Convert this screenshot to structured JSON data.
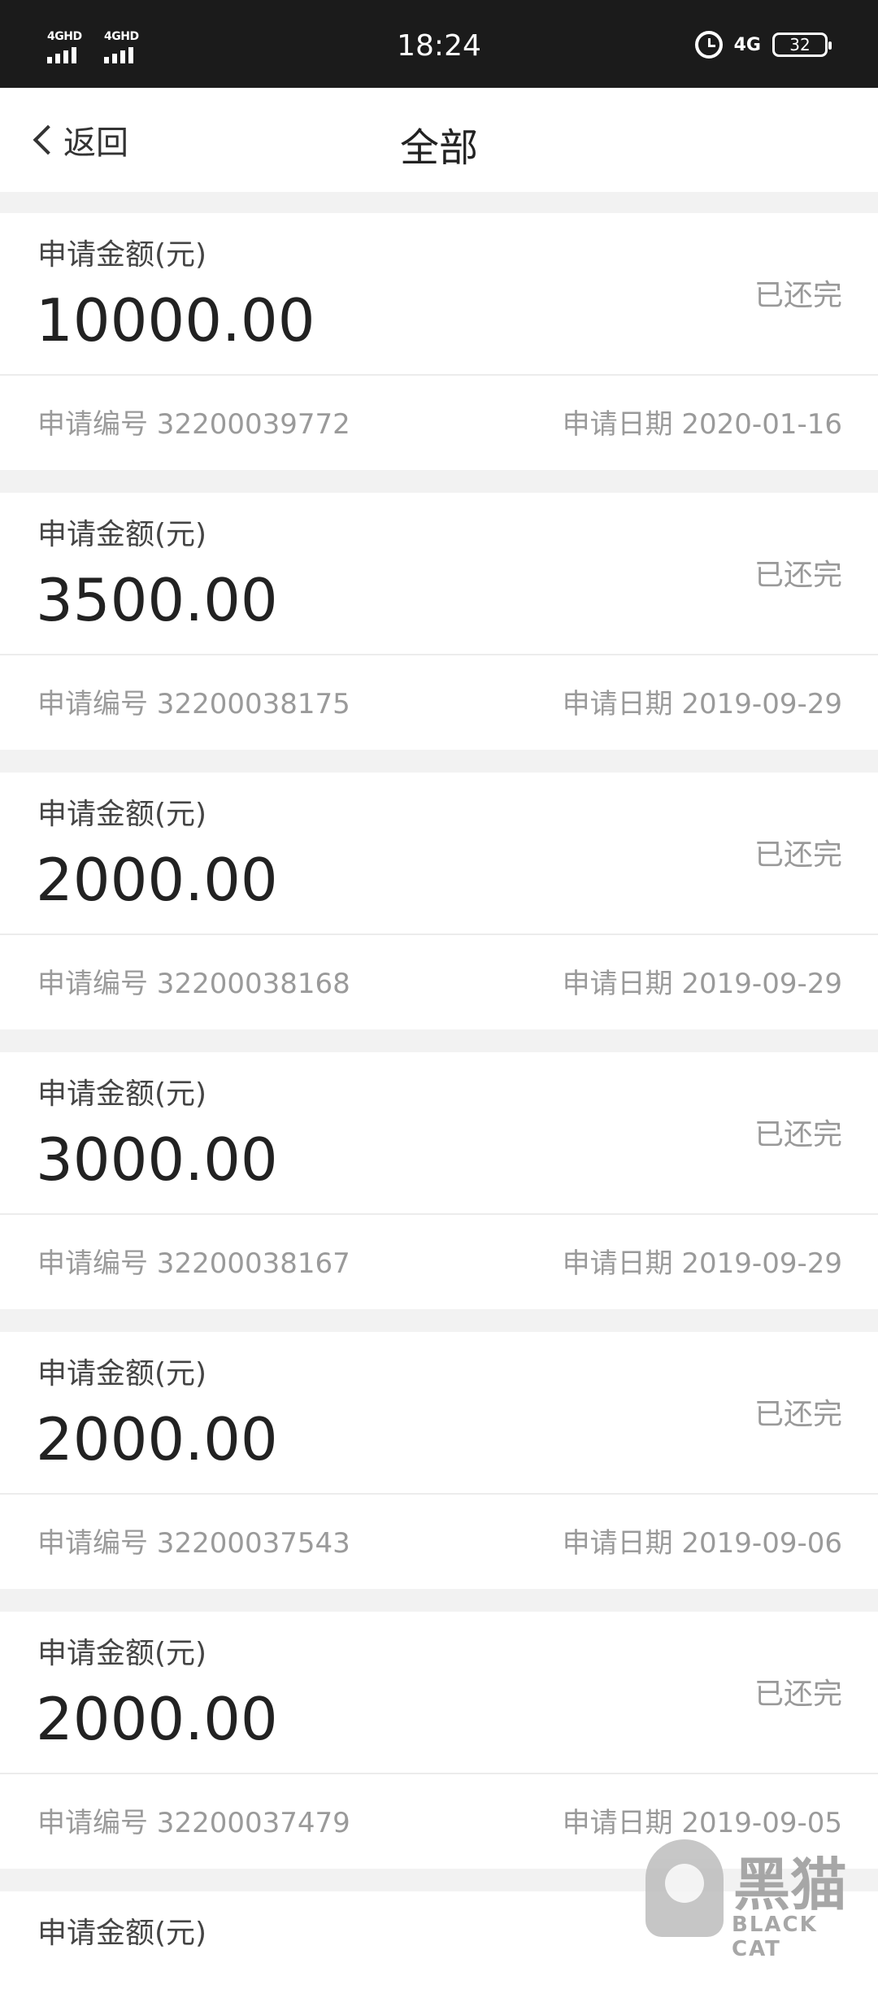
{
  "status_bar": {
    "signal_1_label": "4GHD",
    "signal_2_label": "4GHD",
    "time": "18:24",
    "network": "4G",
    "battery": "32"
  },
  "nav": {
    "back_label": "返回",
    "title": "全部"
  },
  "records": [
    {
      "label": "申请金额(元)",
      "amount": "10000.00",
      "status": "已还完",
      "apply_no": "申请编号 32200039772",
      "apply_date": "申请日期 2020-01-16"
    },
    {
      "label": "申请金额(元)",
      "amount": "3500.00",
      "status": "已还完",
      "apply_no": "申请编号 32200038175",
      "apply_date": "申请日期 2019-09-29"
    },
    {
      "label": "申请金额(元)",
      "amount": "2000.00",
      "status": "已还完",
      "apply_no": "申请编号 32200038168",
      "apply_date": "申请日期 2019-09-29"
    },
    {
      "label": "申请金额(元)",
      "amount": "3000.00",
      "status": "已还完",
      "apply_no": "申请编号 32200038167",
      "apply_date": "申请日期 2019-09-29"
    },
    {
      "label": "申请金额(元)",
      "amount": "2000.00",
      "status": "已还完",
      "apply_no": "申请编号 32200037543",
      "apply_date": "申请日期 2019-09-06"
    },
    {
      "label": "申请金额(元)",
      "amount": "2000.00",
      "status": "已还完",
      "apply_no": "申请编号 32200037479",
      "apply_date": "申请日期 2019-09-05"
    }
  ],
  "partial_record": {
    "label": "申请金额(元)"
  },
  "watermark": {
    "cn": "黑猫",
    "en": "BLACK CAT"
  }
}
